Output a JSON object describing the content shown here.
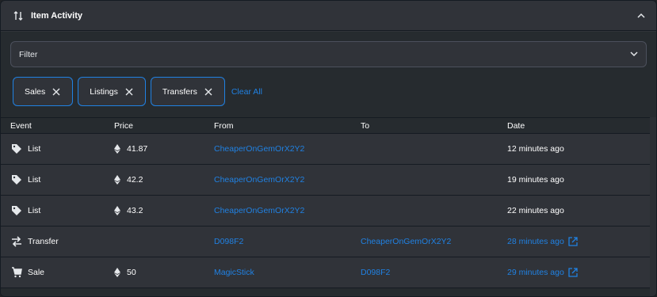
{
  "header": {
    "title": "Item Activity"
  },
  "filter": {
    "label": "Filter"
  },
  "chips": [
    {
      "label": "Sales"
    },
    {
      "label": "Listings"
    },
    {
      "label": "Transfers"
    }
  ],
  "clear_all": "Clear All",
  "table": {
    "columns": [
      "Event",
      "Price",
      "From",
      "To",
      "Date"
    ],
    "rows": [
      {
        "event": "List",
        "event_icon": "tag-icon",
        "price": "41.87",
        "from": "CheaperOnGemOrX2Y2",
        "to": "",
        "date": "12 minutes ago",
        "date_link": false
      },
      {
        "event": "List",
        "event_icon": "tag-icon",
        "price": "42.2",
        "from": "CheaperOnGemOrX2Y2",
        "to": "",
        "date": "19 minutes ago",
        "date_link": false
      },
      {
        "event": "List",
        "event_icon": "tag-icon",
        "price": "43.2",
        "from": "CheaperOnGemOrX2Y2",
        "to": "",
        "date": "22 minutes ago",
        "date_link": false
      },
      {
        "event": "Transfer",
        "event_icon": "transfer-icon",
        "price": "",
        "from": "D098F2",
        "to": "CheaperOnGemOrX2Y2",
        "date": "28 minutes ago",
        "date_link": true
      },
      {
        "event": "Sale",
        "event_icon": "cart-icon",
        "price": "50",
        "from": "MagicStick",
        "to": "D098F2",
        "date": "29 minutes ago",
        "date_link": true
      }
    ]
  },
  "colors": {
    "accent": "#2081e2",
    "panel": "#303339",
    "background": "#262b2f",
    "border": "#151b22"
  }
}
